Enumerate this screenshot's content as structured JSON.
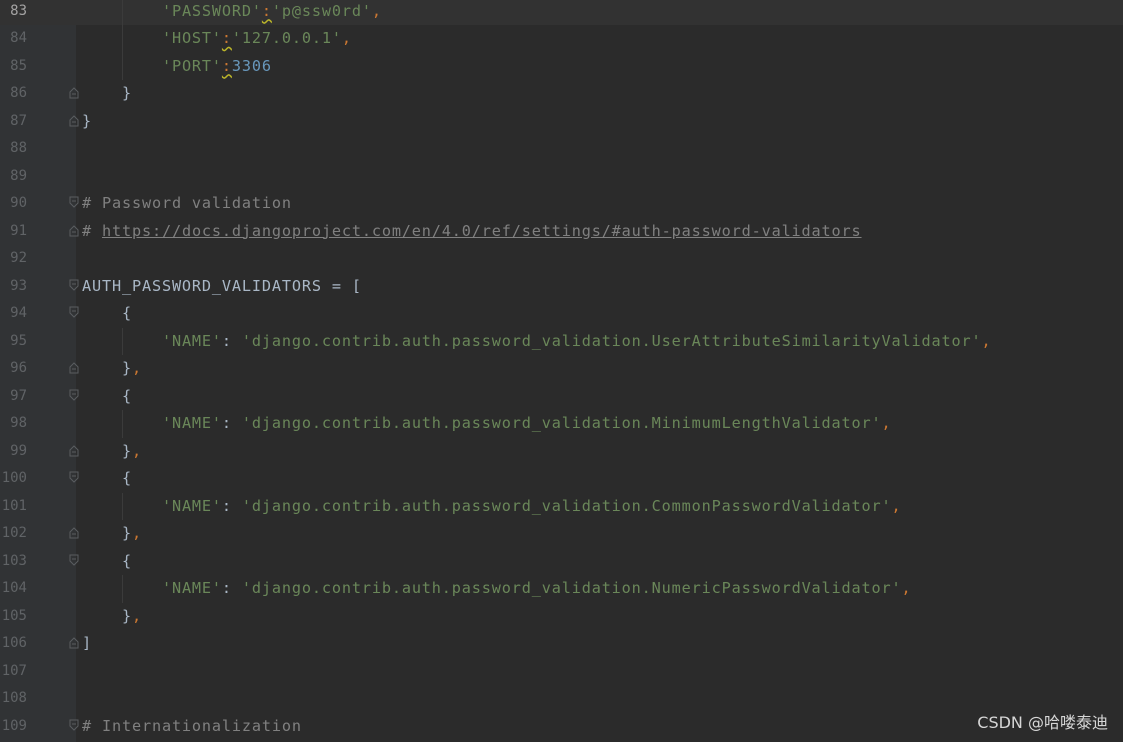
{
  "editor": {
    "current_line": "83",
    "lines": [
      {
        "number": "83",
        "tokens": [
          {
            "t": "        ",
            "c": "plain"
          },
          {
            "t": "'PASSWORD'",
            "c": "str"
          },
          {
            "t": ":",
            "c": "punct warn"
          },
          {
            "t": "'p@ssw0rd'",
            "c": "str"
          },
          {
            "t": ",",
            "c": "punct"
          }
        ]
      },
      {
        "number": "84",
        "tokens": [
          {
            "t": "        ",
            "c": "plain"
          },
          {
            "t": "'HOST'",
            "c": "str"
          },
          {
            "t": ":",
            "c": "punct warn"
          },
          {
            "t": "'127.0.0.1'",
            "c": "str"
          },
          {
            "t": ",",
            "c": "punct"
          }
        ]
      },
      {
        "number": "85",
        "tokens": [
          {
            "t": "        ",
            "c": "plain"
          },
          {
            "t": "'PORT'",
            "c": "str"
          },
          {
            "t": ":",
            "c": "punct warn"
          },
          {
            "t": "3306",
            "c": "num"
          }
        ]
      },
      {
        "number": "86",
        "fold": "end",
        "tokens": [
          {
            "t": "    }",
            "c": "plain"
          }
        ]
      },
      {
        "number": "87",
        "fold": "end",
        "tokens": [
          {
            "t": "}",
            "c": "plain"
          }
        ]
      },
      {
        "number": "88",
        "tokens": []
      },
      {
        "number": "89",
        "tokens": []
      },
      {
        "number": "90",
        "fold": "start",
        "tokens": [
          {
            "t": "# Password validation",
            "c": "comment"
          }
        ]
      },
      {
        "number": "91",
        "fold": "end",
        "tokens": [
          {
            "t": "# ",
            "c": "comment"
          },
          {
            "t": "https://docs.djangoproject.com/en/4.0/ref/settings/#auth-password-validators",
            "c": "link"
          }
        ]
      },
      {
        "number": "92",
        "tokens": []
      },
      {
        "number": "93",
        "fold": "start",
        "tokens": [
          {
            "t": "AUTH_PASSWORD_VALIDATORS = [",
            "c": "plain"
          }
        ]
      },
      {
        "number": "94",
        "fold": "start",
        "tokens": [
          {
            "t": "    {",
            "c": "plain"
          }
        ]
      },
      {
        "number": "95",
        "tokens": [
          {
            "t": "        ",
            "c": "plain"
          },
          {
            "t": "'NAME'",
            "c": "str"
          },
          {
            "t": ": ",
            "c": "plain"
          },
          {
            "t": "'django.contrib.auth.password_validation.UserAttributeSimilarityValidator'",
            "c": "str"
          },
          {
            "t": ",",
            "c": "punct"
          }
        ]
      },
      {
        "number": "96",
        "fold": "end",
        "tokens": [
          {
            "t": "    }",
            "c": "plain"
          },
          {
            "t": ",",
            "c": "punct"
          }
        ]
      },
      {
        "number": "97",
        "fold": "start",
        "tokens": [
          {
            "t": "    {",
            "c": "plain"
          }
        ]
      },
      {
        "number": "98",
        "tokens": [
          {
            "t": "        ",
            "c": "plain"
          },
          {
            "t": "'NAME'",
            "c": "str"
          },
          {
            "t": ": ",
            "c": "plain"
          },
          {
            "t": "'django.contrib.auth.password_validation.MinimumLengthValidator'",
            "c": "str"
          },
          {
            "t": ",",
            "c": "punct"
          }
        ]
      },
      {
        "number": "99",
        "fold": "end",
        "tokens": [
          {
            "t": "    }",
            "c": "plain"
          },
          {
            "t": ",",
            "c": "punct"
          }
        ]
      },
      {
        "number": "100",
        "fold": "start",
        "tokens": [
          {
            "t": "    {",
            "c": "plain"
          }
        ]
      },
      {
        "number": "101",
        "tokens": [
          {
            "t": "        ",
            "c": "plain"
          },
          {
            "t": "'NAME'",
            "c": "str"
          },
          {
            "t": ": ",
            "c": "plain"
          },
          {
            "t": "'django.contrib.auth.password_validation.CommonPasswordValidator'",
            "c": "str"
          },
          {
            "t": ",",
            "c": "punct"
          }
        ]
      },
      {
        "number": "102",
        "fold": "end",
        "tokens": [
          {
            "t": "    }",
            "c": "plain"
          },
          {
            "t": ",",
            "c": "punct"
          }
        ]
      },
      {
        "number": "103",
        "fold": "start",
        "tokens": [
          {
            "t": "    {",
            "c": "plain"
          }
        ]
      },
      {
        "number": "104",
        "tokens": [
          {
            "t": "        ",
            "c": "plain"
          },
          {
            "t": "'NAME'",
            "c": "str"
          },
          {
            "t": ": ",
            "c": "plain"
          },
          {
            "t": "'django.contrib.auth.password_validation.NumericPasswordValidator'",
            "c": "str"
          },
          {
            "t": ",",
            "c": "punct"
          }
        ]
      },
      {
        "number": "105",
        "tokens": [
          {
            "t": "    }",
            "c": "plain"
          },
          {
            "t": ",",
            "c": "punct"
          }
        ]
      },
      {
        "number": "106",
        "fold": "end",
        "tokens": [
          {
            "t": "]",
            "c": "plain"
          }
        ]
      },
      {
        "number": "107",
        "tokens": []
      },
      {
        "number": "108",
        "tokens": []
      },
      {
        "number": "109",
        "fold": "start",
        "tokens": [
          {
            "t": "# Internationalization",
            "c": "comment"
          }
        ]
      }
    ]
  },
  "watermark": "CSDN @哈喽泰迪",
  "colors": {
    "background": "#2b2b2b",
    "gutter": "#313335",
    "string": "#6a8759",
    "number": "#6897bb",
    "keyword_punct": "#cc7832",
    "comment": "#808080",
    "text": "#a9b7c6",
    "line_number": "#606366"
  }
}
